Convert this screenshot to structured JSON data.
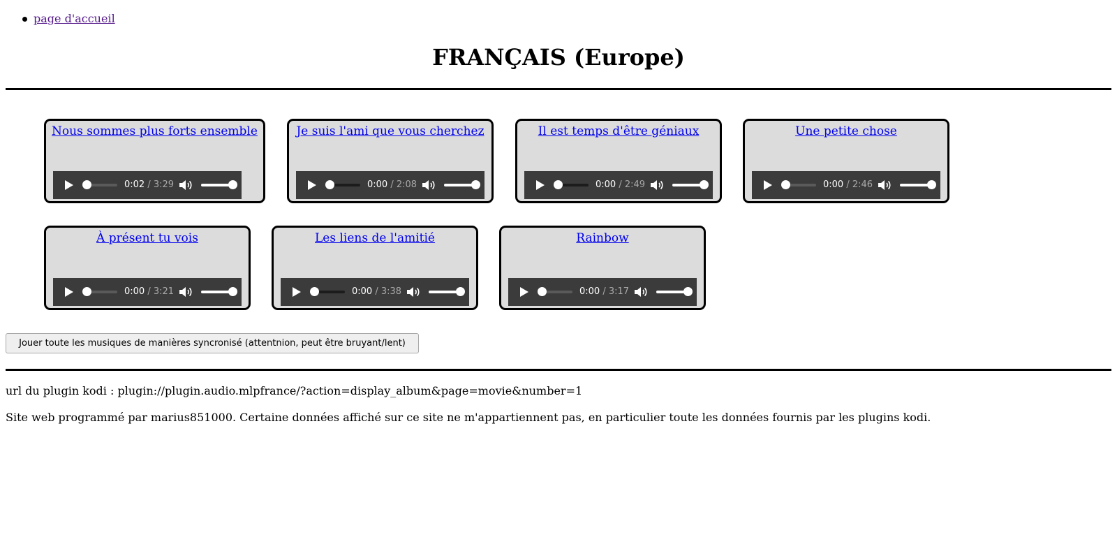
{
  "nav": {
    "home_link": "page d'accueil"
  },
  "header": {
    "title": "FRANÇAIS (Europe)"
  },
  "tracks": [
    {
      "title": "Nous sommes plus forts ensemble",
      "current_time": "0:02",
      "duration": "/ 3:29",
      "progress": 0.01
    },
    {
      "title": "Je suis l'ami que vous cherchez",
      "current_time": "0:00",
      "duration": "/ 2:08",
      "progress": 0.0
    },
    {
      "title": "Il est temps d'être géniaux",
      "current_time": "0:00",
      "duration": "/ 2:49",
      "progress": 0.0
    },
    {
      "title": "Une petite chose",
      "current_time": "0:00",
      "duration": "/ 2:46",
      "progress": 0.0
    },
    {
      "title": "À présent tu vois",
      "current_time": "0:00",
      "duration": "/ 3:21",
      "progress": 0.0
    },
    {
      "title": "Les liens de l'amitié",
      "current_time": "0:00",
      "duration": "/ 3:38",
      "progress": 0.0
    },
    {
      "title": "Rainbow",
      "current_time": "0:00",
      "duration": "/ 3:17",
      "progress": 0.0
    }
  ],
  "controls": {
    "sync_play_label": "Jouer toute les musiques de manières syncronisé (attentnion, peut être bruyant/lent)"
  },
  "footer": {
    "plugin_url": "url du plugin kodi : plugin://plugin.audio.mlpfrance/?action=display_album&page=movie&number=1",
    "credits": "Site web programmé par marius851000. Certaine données affiché sur ce site ne m'appartiennent pas, en particulier toute les données fournis par les plugins kodi."
  },
  "icons": {
    "play": "play-icon",
    "volume": "volume-icon"
  }
}
